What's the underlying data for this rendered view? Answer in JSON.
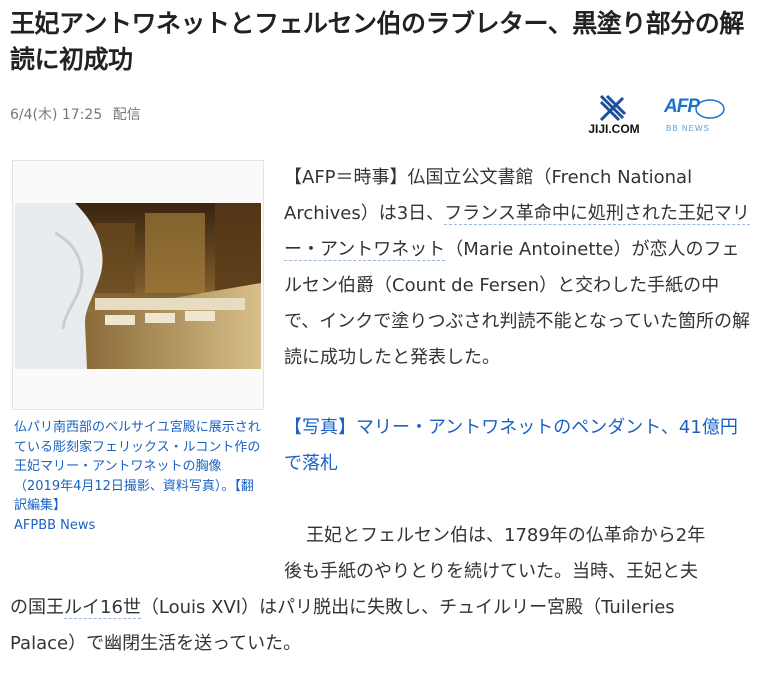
{
  "headline": "王妃アントワネットとフェルセン伯のラブレター、黒塗り部分の解読に初成功",
  "meta": {
    "date": "6/4(木) 17:25",
    "distribution": "配信"
  },
  "logos": {
    "jiji": "JIJI.COM",
    "afp": "AFP",
    "afp_sub": "BB NEWS"
  },
  "photo": {
    "caption": "仏パリ南西部のベルサイユ宮殿に展示されている彫刻家フェリックス・ルコント作の王妃マリー・アントワネットの胸像（2019年4月12日撮影、資料写真）。【翻訳編集】",
    "credit": "AFPBB News"
  },
  "article": {
    "p1_a": "【AFP＝時事】仏国立公文書館（French National Archives）は3日、",
    "p1_link1": "フランス革命中に処刑された王妃マリー・アントワネット",
    "p1_b": "（Marie Antoinette）が恋人のフェルセン伯爵（Count de Fersen）と交わした手紙の中で、インクで塗りつぶされ判読不能となっていた箇所の解読に成功したと発表した。",
    "photo_link": "【写真】マリー・アントワネットのペンダント、41億円で落札",
    "p2_line1": "王妃とフェルセン伯は、1789年の仏革命から2年",
    "p2_line2": "後も手紙のやりとりを続けていた。当時、王妃と夫",
    "p2_line3_a": "の国王",
    "p2_line3_link": "ルイ16世",
    "p2_line3_b": "（Louis XVI）はパリ脱出に失敗し、チュイルリー宮殿（Tuileries",
    "p2_line4": "Palace）で幽閉生活を送っていた。"
  }
}
